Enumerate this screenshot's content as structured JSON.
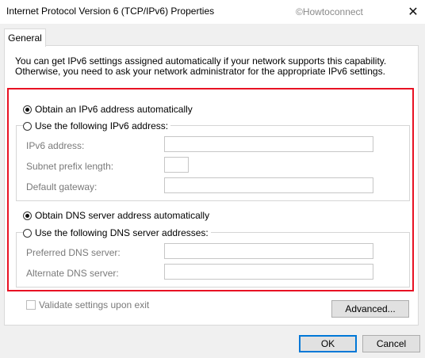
{
  "window": {
    "title": "Internet Protocol Version 6 (TCP/IPv6) Properties",
    "watermark": "©Howtoconnect",
    "close_glyph": "✕"
  },
  "tabs": [
    {
      "label": "General",
      "active": true
    }
  ],
  "description": {
    "line1": "You can get IPv6 settings assigned automatically if your network supports this capability.",
    "line2": "Otherwise, you need to ask your network administrator for the appropriate IPv6 settings."
  },
  "ip_section": {
    "auto_label": "Obtain an IPv6 address automatically",
    "auto_checked": true,
    "manual_label": "Use the following IPv6 address:",
    "manual_checked": false,
    "fields": {
      "ipv6_address": {
        "label": "IPv6 address:",
        "value": ""
      },
      "subnet_prefix": {
        "label": "Subnet prefix length:",
        "value": ""
      },
      "gateway": {
        "label": "Default gateway:",
        "value": ""
      }
    }
  },
  "dns_section": {
    "auto_label": "Obtain DNS server address automatically",
    "auto_checked": true,
    "manual_label": "Use the following DNS server addresses:",
    "manual_checked": false,
    "fields": {
      "preferred": {
        "label": "Preferred DNS server:",
        "value": ""
      },
      "alternate": {
        "label": "Alternate DNS server:",
        "value": ""
      }
    }
  },
  "validate": {
    "label": "Validate settings upon exit",
    "checked": false
  },
  "buttons": {
    "advanced": "Advanced...",
    "ok": "OK",
    "cancel": "Cancel"
  },
  "colors": {
    "highlight": "#e81123",
    "accent": "#0078d7"
  }
}
